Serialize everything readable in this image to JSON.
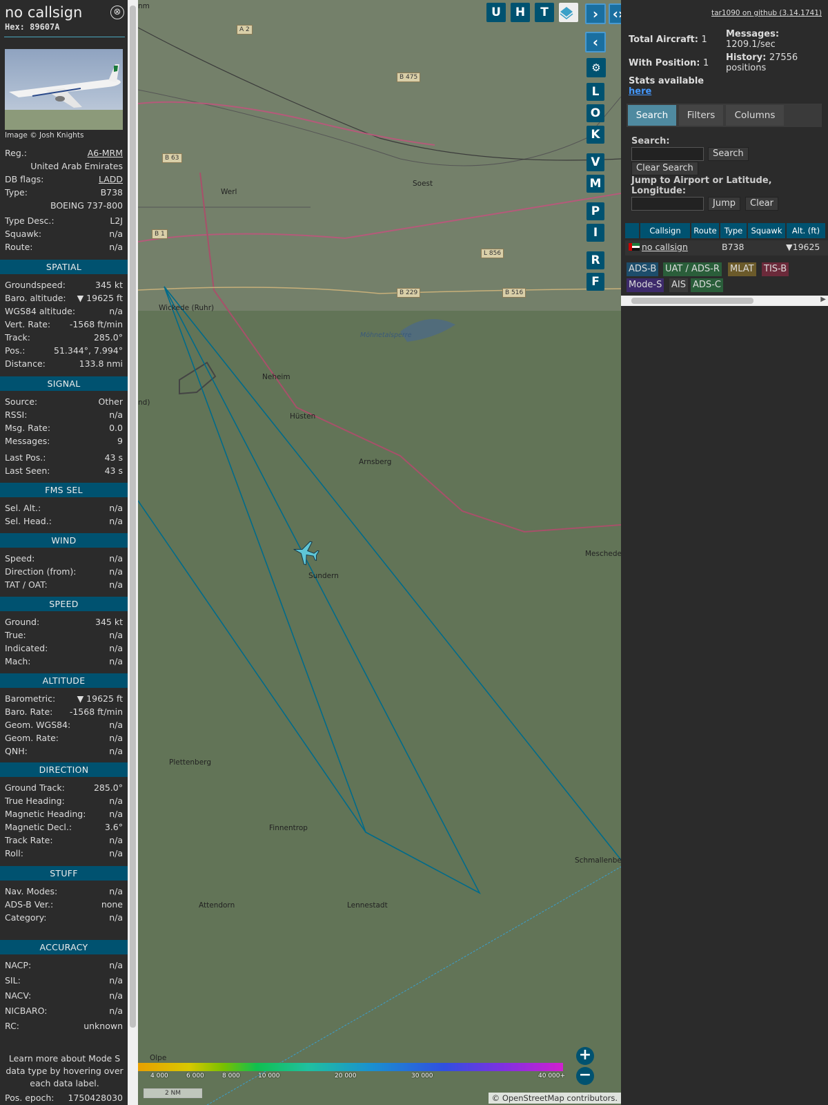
{
  "sidebar": {
    "title": "no callsign",
    "hex": "Hex: 89607A",
    "close_icon": "⊗",
    "photo_credit": "Image © Josh Knights",
    "info": [
      {
        "k": "Reg.:",
        "v": "A6-MRM"
      },
      {
        "k": "",
        "v": "United Arab Emirates"
      },
      {
        "k": "DB flags:",
        "v": "LADD"
      },
      {
        "k": "Type:",
        "v": "B738"
      },
      {
        "k": "",
        "v": "BOEING 737-800"
      },
      {
        "k": "Type Desc.:",
        "v": "L2J"
      },
      {
        "k": "Squawk:",
        "v": "n/a"
      },
      {
        "k": "Route:",
        "v": "n/a"
      }
    ],
    "sections": {
      "spatial": "SPATIAL",
      "signal": "SIGNAL",
      "fms": "FMS SEL",
      "wind": "WIND",
      "speed": "SPEED",
      "altitude": "ALTITUDE",
      "direction": "DIRECTION",
      "stuff": "STUFF",
      "accuracy": "ACCURACY"
    },
    "spatial": [
      {
        "k": "Groundspeed:",
        "v": "345 kt"
      },
      {
        "k": "Baro. altitude:",
        "v": "▼ 19625 ft"
      },
      {
        "k": "WGS84 altitude:",
        "v": "n/a"
      },
      {
        "k": "Vert. Rate:",
        "v": "-1568 ft/min"
      },
      {
        "k": "Track:",
        "v": "285.0°"
      },
      {
        "k": "Pos.:",
        "v": "51.344°, 7.994°"
      },
      {
        "k": "Distance:",
        "v": "133.8 nmi"
      }
    ],
    "signal": [
      {
        "k": "Source:",
        "v": "Other"
      },
      {
        "k": "RSSI:",
        "v": "n/a"
      },
      {
        "k": "Msg. Rate:",
        "v": "0.0"
      },
      {
        "k": "Messages:",
        "v": "9"
      },
      {
        "k": "Last Pos.:",
        "v": "43 s"
      },
      {
        "k": "Last Seen:",
        "v": "43 s"
      }
    ],
    "fms": [
      {
        "k": "Sel. Alt.:",
        "v": "n/a"
      },
      {
        "k": "Sel. Head.:",
        "v": "n/a"
      }
    ],
    "wind": [
      {
        "k": "Speed:",
        "v": "n/a"
      },
      {
        "k": "Direction (from):",
        "v": "n/a"
      },
      {
        "k": "TAT / OAT:",
        "v": "n/a"
      }
    ],
    "speed": [
      {
        "k": "Ground:",
        "v": "345 kt"
      },
      {
        "k": "True:",
        "v": "n/a"
      },
      {
        "k": "Indicated:",
        "v": "n/a"
      },
      {
        "k": "Mach:",
        "v": "n/a"
      }
    ],
    "altitude": [
      {
        "k": "Barometric:",
        "v": "▼ 19625 ft"
      },
      {
        "k": "Baro. Rate:",
        "v": "-1568 ft/min"
      },
      {
        "k": "Geom. WGS84:",
        "v": "n/a"
      },
      {
        "k": "Geom. Rate:",
        "v": "n/a"
      },
      {
        "k": "QNH:",
        "v": "n/a"
      }
    ],
    "direction": [
      {
        "k": "Ground Track:",
        "v": "285.0°"
      },
      {
        "k": "True Heading:",
        "v": "n/a"
      },
      {
        "k": "Magnetic Heading:",
        "v": "n/a"
      },
      {
        "k": "Magnetic Decl.:",
        "v": "3.6°"
      },
      {
        "k": "Track Rate:",
        "v": "n/a"
      },
      {
        "k": "Roll:",
        "v": "n/a"
      }
    ],
    "stuff": [
      {
        "k": "Nav. Modes:",
        "v": "n/a"
      },
      {
        "k": "ADS-B Ver.:",
        "v": "none"
      },
      {
        "k": "Category:",
        "v": "n/a"
      }
    ],
    "accuracy": [
      {
        "k": "NACP:",
        "v": "n/a"
      },
      {
        "k": "SIL:",
        "v": "n/a"
      },
      {
        "k": "NACV:",
        "v": "n/a"
      },
      {
        "k": "NICBARO:",
        "v": "n/a"
      },
      {
        "k": "RC:",
        "v": "unknown"
      }
    ],
    "note": "Learn more about Mode S data type by hovering over each data label.",
    "epoch": {
      "k": "Pos. epoch:",
      "v": "1750428030"
    }
  },
  "map": {
    "places": [
      "Werl",
      "Soest",
      "Wickede (Ruhr)",
      "Neheim",
      "Hüsten",
      "Arnsberg",
      "Möhnetalsperre",
      "Sundern",
      "Meschede",
      "Plettenberg",
      "Finnentrop",
      "Schmallenberg",
      "Attendorn",
      "Lennestadt",
      "Olpe",
      "nd)",
      "nm"
    ],
    "roads": [
      "A 2",
      "B 475",
      "B 63",
      "B 1",
      "B 229",
      "B 516",
      "L 856"
    ],
    "top_buttons": [
      "U",
      "H",
      "T"
    ],
    "side_buttons": [
      "L",
      "O",
      "K",
      "V",
      "M",
      "P",
      "I",
      "R",
      "F"
    ],
    "layers_icon": "layers-icon",
    "legend_labels": [
      "4 000",
      "6 000",
      "8 000",
      "10 000",
      "20 000",
      "30 000",
      "40 000+"
    ],
    "scale": "2 NM",
    "attribution": "© OpenStreetMap contributors.",
    "zoom_in": "+",
    "zoom_out": "−"
  },
  "right": {
    "github": "tar1090 on github (3.14.1741)",
    "total_label": "Total Aircraft:",
    "total_value": "1",
    "position_label": "With Position:",
    "position_value": "1",
    "messages_label": "Messages:",
    "messages_value": "1209.1/sec",
    "history_label": "History:",
    "history_value": "27556 positions",
    "stats_label": "Stats available",
    "stats_link": "here",
    "tabs": [
      "Search",
      "Filters",
      "Columns"
    ],
    "search_label": "Search:",
    "search_btn": "Search",
    "clear_search_btn": "Clear Search",
    "jump_label": "Jump to Airport or Latitude, Longitude:",
    "jump_btn": "Jump",
    "clear_btn": "Clear",
    "table_headers": [
      "Callsign",
      "Route",
      "Type",
      "Squawk",
      "Alt. (ft)"
    ],
    "row": {
      "callsign": "no callsign",
      "type": "B738",
      "alt": "▼19625"
    },
    "badges": [
      {
        "label": "ADS-B",
        "color": "#1d4d6b"
      },
      {
        "label": "UAT / ADS-R",
        "color": "#2a5e3a"
      },
      {
        "label": "MLAT",
        "color": "#6b5a2a"
      },
      {
        "label": "TIS-B",
        "color": "#6b2a3a"
      },
      {
        "label": "Mode-S",
        "color": "#3d2a6b"
      },
      {
        "label": "AIS",
        "color": "#3a3a3a"
      },
      {
        "label": "ADS-C",
        "color": "#2a5e3a"
      }
    ]
  }
}
